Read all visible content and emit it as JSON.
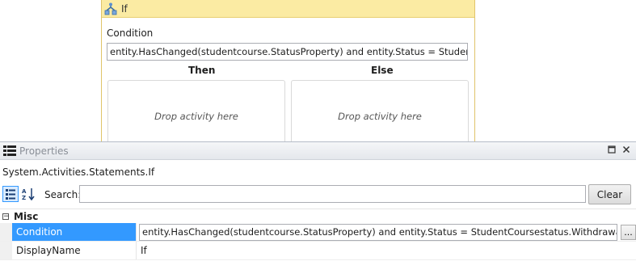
{
  "designer": {
    "activity_title": "If",
    "condition_label": "Condition",
    "condition_text": "entity.HasChanged(studentcourse.StatusProperty) and entity.Status = StudentCoursestatus.Withdrawal",
    "then_label": "Then",
    "else_label": "Else",
    "then_drop": "Drop activity here",
    "else_drop": "Drop activity here"
  },
  "properties": {
    "title": "Properties",
    "type_name": "System.Activities.Statements.If",
    "search_label": "Search:",
    "search_value": "",
    "clear_label": "Clear",
    "category": "Misc",
    "rows": [
      {
        "name": "Condition",
        "value": "entity.HasChanged(studentcourse.StatusProperty) and entity.Status = StudentCoursestatus.Withdrawal",
        "selected": true
      },
      {
        "name": "DisplayName",
        "value": "If",
        "selected": false
      }
    ],
    "ellipsis_label": "..."
  },
  "colors": {
    "header_yellow": "#fbeba3",
    "selection_blue": "#3399ff"
  }
}
